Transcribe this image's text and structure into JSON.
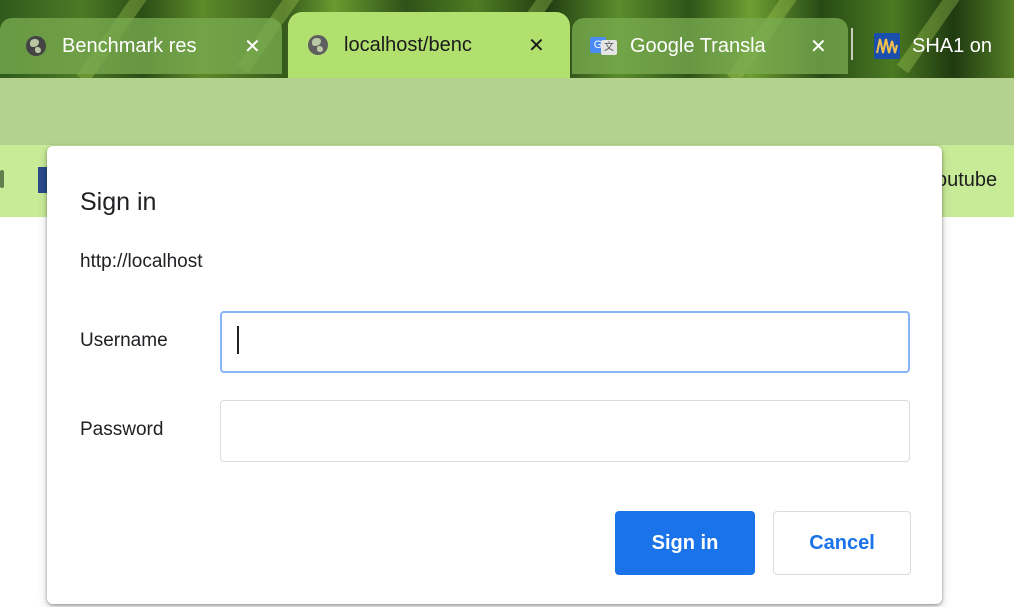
{
  "browser": {
    "tabs": [
      {
        "title": "Benchmark res",
        "icon": "globe-icon",
        "active": false
      },
      {
        "title": "localhost/benc",
        "icon": "globe-icon",
        "active": true
      },
      {
        "title": "Google Transla",
        "icon": "google-translate-icon",
        "active": false
      },
      {
        "title": "SHA1 on",
        "icon": "sha1-site-icon",
        "active": false
      }
    ],
    "close_glyph": "✕",
    "bookmarks": {
      "right_item": "outube"
    }
  },
  "dialog": {
    "title": "Sign in",
    "origin": "http://localhost",
    "username_label": "Username",
    "username_value": "",
    "password_label": "Password",
    "password_value": "",
    "sign_in_label": "Sign in",
    "cancel_label": "Cancel"
  },
  "colors": {
    "primary": "#1a73e8",
    "active_tab": "#b2e06f",
    "toolbar": "#b4d18f",
    "bookmarks_bar": "#c8eb98",
    "focus_ring": "#8ab4f8"
  }
}
